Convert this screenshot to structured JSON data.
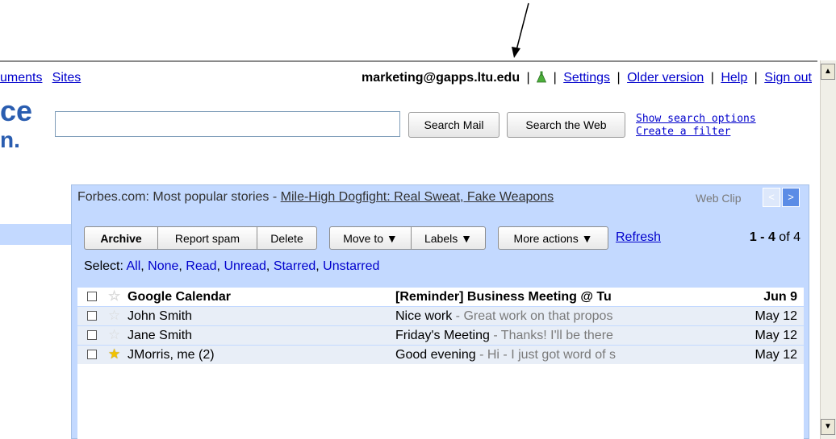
{
  "top_links": {
    "documents": "uments",
    "sites": "Sites"
  },
  "user_bar": {
    "email": "marketing@gapps.ltu.edu",
    "separator": "|",
    "settings": "Settings",
    "older_version": "Older version",
    "help": "Help",
    "sign_out": "Sign out"
  },
  "logo": {
    "line1": "ce",
    "line2": "n."
  },
  "search": {
    "value": "",
    "search_mail": "Search Mail",
    "search_web": "Search the Web",
    "show_options": "Show search options",
    "create_filter": "Create a filter"
  },
  "web_clip": {
    "source": "Forbes.com: Most popular stories - ",
    "headline": "Mile-High Dogfight: Real Sweat, Fake Weapons",
    "label": "Web Clip",
    "prev": "<",
    "next": ">"
  },
  "toolbar": {
    "archive": "Archive",
    "report_spam": "Report spam",
    "delete": "Delete",
    "move_to": "Move to ▼",
    "labels": "Labels ▼",
    "more_actions": "More actions ▼",
    "refresh": "Refresh",
    "range": "1 - 4",
    "of": "of",
    "total": "4"
  },
  "select": {
    "label": "Select: ",
    "options": [
      "All",
      "None",
      "Read",
      "Unread",
      "Starred",
      "Unstarred"
    ]
  },
  "messages": [
    {
      "sender": "Google Calendar",
      "subject": "[Reminder] Business Meeting @ Tu",
      "snippet": "",
      "date": "Jun 9",
      "unread": true,
      "starred": false
    },
    {
      "sender": "John Smith",
      "subject": "Nice work",
      "snippet": " - Great work on that propos",
      "date": "May 12",
      "unread": false,
      "starred": false
    },
    {
      "sender": "Jane Smith",
      "subject": "Friday's Meeting",
      "snippet": " - Thanks! I'll be there",
      "date": "May 12",
      "unread": false,
      "starred": false
    },
    {
      "sender": "JMorris, me (2)",
      "subject": "Good evening",
      "snippet": " - Hi - I just got word of s",
      "date": "May 12",
      "unread": false,
      "starred": true
    }
  ],
  "icons": {
    "labs": "labs-flask-icon",
    "star": "star-icon",
    "checkbox": "checkbox-icon"
  },
  "colors": {
    "panel": "#c3d9ff",
    "link": "#0000cc",
    "read_row": "#e8eef7",
    "logo": "#2a5db0"
  }
}
